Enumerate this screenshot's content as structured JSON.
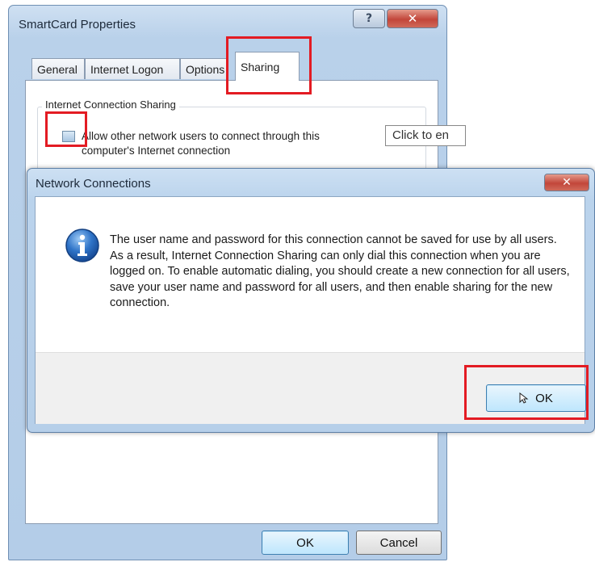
{
  "props_dialog": {
    "title": "SmartCard Properties",
    "help_button": "?",
    "close_button": "✕",
    "tabs": [
      {
        "label": "General"
      },
      {
        "label": "Internet Logon"
      },
      {
        "label": "Options"
      },
      {
        "label": "Sharing"
      }
    ],
    "group_title": "Internet Connection Sharing",
    "checkbox_label": "Allow other network users to connect through this computer's Internet connection",
    "tooltip": "Click to en",
    "ok_button": "OK",
    "cancel_button": "Cancel"
  },
  "message_dialog": {
    "title": "Network Connections",
    "close_button": "✕",
    "icon": "info-icon",
    "message": "The user name and password for this connection cannot be saved for use by all users.  As a result,  Internet Connection Sharing can only dial this connection when you are logged on.  To enable automatic dialing, you should create a new connection for all users, save your user name and password for all users, and then enable sharing for the new connection.",
    "ok_button": "OK"
  },
  "colors": {
    "highlight": "#e31b23",
    "window_frame": "#b9d1ea",
    "close_button": "#c2463a"
  }
}
